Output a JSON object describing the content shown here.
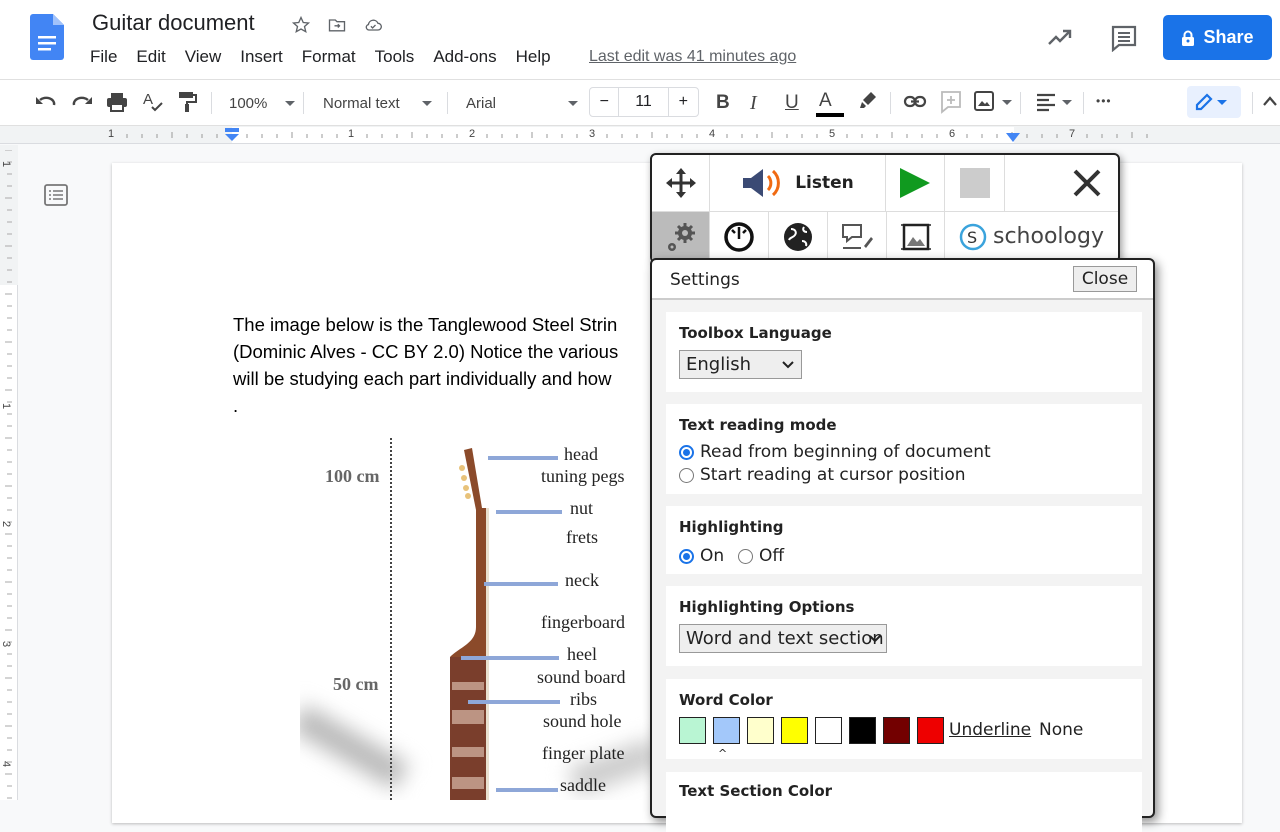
{
  "app": {
    "doc_title": "Guitar document",
    "menu": [
      "File",
      "Edit",
      "View",
      "Insert",
      "Format",
      "Tools",
      "Add-ons",
      "Help"
    ],
    "last_edit": "Last edit was 41 minutes ago",
    "share_label": "Share"
  },
  "toolbar": {
    "zoom": "100%",
    "style": "Normal text",
    "font": "Arial",
    "font_size": "11",
    "minus": "−",
    "plus": "+",
    "bold": "B",
    "italic": "I",
    "underline": "U",
    "text_color": "A",
    "more": "•••"
  },
  "ruler": {
    "h_numbers": [
      "1",
      "1",
      "2",
      "3",
      "4",
      "5",
      "6",
      "7"
    ],
    "v_numbers": [
      "1",
      "1",
      "2",
      "3",
      "4"
    ]
  },
  "document": {
    "lines": [
      "The image below is the Tanglewood Steel Strin",
      "(Dominic Alves - CC BY 2.0)  Notice the various",
      "will be studying each part individually and how ",
      "."
    ],
    "figure": {
      "scale_labels": [
        "100 cm",
        "50 cm"
      ],
      "parts": [
        "head",
        "tuning pegs",
        "nut",
        "frets",
        "neck",
        "fingerboard",
        "heel",
        "sound board",
        "ribs",
        "sound hole",
        "finger plate",
        "saddle"
      ]
    }
  },
  "toolbox": {
    "listen_label": "Listen",
    "schoology_label": "schoology"
  },
  "settings": {
    "title": "Settings",
    "close_label": "Close",
    "toolbox_language": {
      "title": "Toolbox Language",
      "value": "English"
    },
    "reading_mode": {
      "title": "Text reading mode",
      "options": [
        "Read from beginning of document",
        "Start reading at cursor position"
      ],
      "selected": 0
    },
    "highlighting": {
      "title": "Highlighting",
      "on_label": "On",
      "off_label": "Off",
      "value": "On"
    },
    "highlighting_options": {
      "title": "Highlighting Options",
      "value": "Word and text section"
    },
    "word_color": {
      "title": "Word Color",
      "swatches": [
        "#b9f5d3",
        "#a3c8fa",
        "#ffffcc",
        "#ffff00",
        "#ffffff",
        "#000000",
        "#730000",
        "#ee0000"
      ],
      "selected_index": 1,
      "underline_label": "Underline",
      "none_label": "None"
    },
    "text_section_color": {
      "title": "Text Section Color"
    }
  },
  "colors": {
    "accent": "#1a73e8",
    "play": "#109a1f"
  }
}
